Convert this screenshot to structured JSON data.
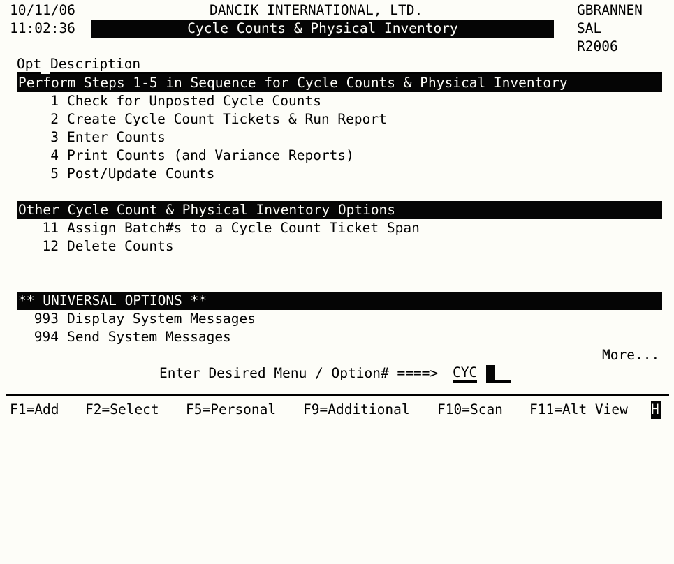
{
  "header": {
    "date": "10/11/06",
    "time": "11:02:36",
    "company": "DANCIK INTERNATIONAL, LTD.",
    "screen_title": "Cycle Counts & Physical Inventory",
    "user": "GBRANNEN",
    "company_code": "SAL",
    "program_id": "R2006"
  },
  "columns": {
    "opt": "Opt",
    "description": "Description"
  },
  "sections": [
    {
      "heading": "Perform Steps 1-5 in Sequence for Cycle Counts & Physical Inventory",
      "items": [
        {
          "opt": "1",
          "label": "Check for Unposted Cycle Counts"
        },
        {
          "opt": "2",
          "label": "Create Cycle Count Tickets & Run Report"
        },
        {
          "opt": "3",
          "label": "Enter Counts"
        },
        {
          "opt": "4",
          "label": "Print Counts (and Variance Reports)"
        },
        {
          "opt": "5",
          "label": "Post/Update Counts"
        }
      ]
    },
    {
      "heading": "Other Cycle Count & Physical Inventory Options",
      "items": [
        {
          "opt": "11",
          "label": "Assign Batch#s to a Cycle Count Ticket Span"
        },
        {
          "opt": "12",
          "label": "Delete Counts"
        }
      ]
    },
    {
      "heading": "** UNIVERSAL OPTIONS **",
      "items": [
        {
          "opt": "993",
          "label": "Display System Messages"
        },
        {
          "opt": "994",
          "label": "Send System Messages"
        }
      ]
    }
  ],
  "more_indicator": "More...",
  "prompt": {
    "label": "Enter Desired Menu / Option# ====>",
    "value": "CYC",
    "trailing_blank": " "
  },
  "function_keys": [
    {
      "key": "F1",
      "label": "F1=Add"
    },
    {
      "key": "F2",
      "label": "F2=Select"
    },
    {
      "key": "F5",
      "label": "F5=Personal"
    },
    {
      "key": "F9",
      "label": "F9=Additional"
    },
    {
      "key": "F10",
      "label": "F10=Scan"
    },
    {
      "key": "F11",
      "label": "F11=Alt View"
    }
  ],
  "status_indicator": "H",
  "colors": {
    "background": "#fdfdf8",
    "foreground": "#000000",
    "reverse_bg": "#050505",
    "reverse_fg": "#fdfdf8"
  }
}
